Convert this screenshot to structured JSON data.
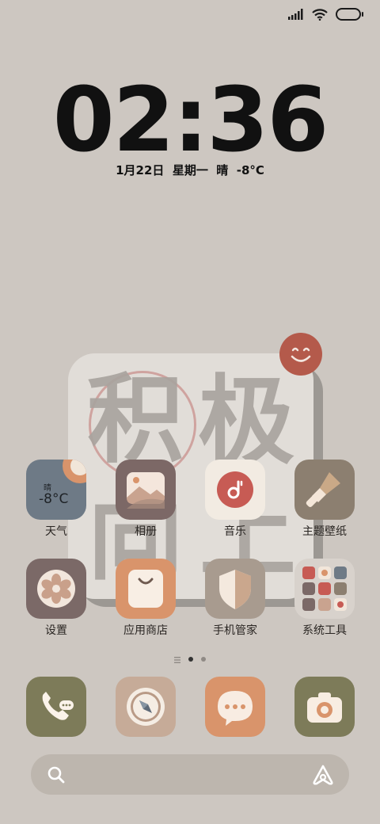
{
  "status_bar": {
    "signal_icon": "signal-bars-icon",
    "wifi_icon": "wifi-icon",
    "battery_icon": "battery-icon"
  },
  "lock": {
    "time": "02:36",
    "date_line": "1月22日  星期一  晴  -8°C"
  },
  "widget": {
    "calligraphy": [
      "积",
      "极",
      "向",
      "上"
    ],
    "badge_icon": "smiley-icon"
  },
  "apps_row1": [
    {
      "label": "天气",
      "icon": "weather-icon",
      "weather_condition": "晴",
      "weather_temp": "-8°C"
    },
    {
      "label": "相册",
      "icon": "gallery-icon"
    },
    {
      "label": "音乐",
      "icon": "music-icon"
    },
    {
      "label": "主题壁纸",
      "icon": "brush-icon"
    }
  ],
  "apps_row2": [
    {
      "label": "设置",
      "icon": "gear-flower-icon"
    },
    {
      "label": "应用商店",
      "icon": "shopping-bag-icon"
    },
    {
      "label": "手机管家",
      "icon": "shield-icon"
    },
    {
      "label": "系统工具",
      "icon": "folder-icon"
    }
  ],
  "page_indicator": {
    "pages": 2,
    "current": 1
  },
  "dock": [
    {
      "icon": "phone-icon"
    },
    {
      "icon": "compass-icon"
    },
    {
      "icon": "message-icon"
    },
    {
      "icon": "camera-icon"
    }
  ],
  "search_bar": {
    "search_icon": "search-icon",
    "assistant_icon": "assistant-icon"
  },
  "colors": {
    "background": "#cdc7c1",
    "widget": "#e1ddd8",
    "accent_red": "#b45a4b",
    "accent_orange": "#d9946b",
    "olive": "#7d7b59"
  }
}
